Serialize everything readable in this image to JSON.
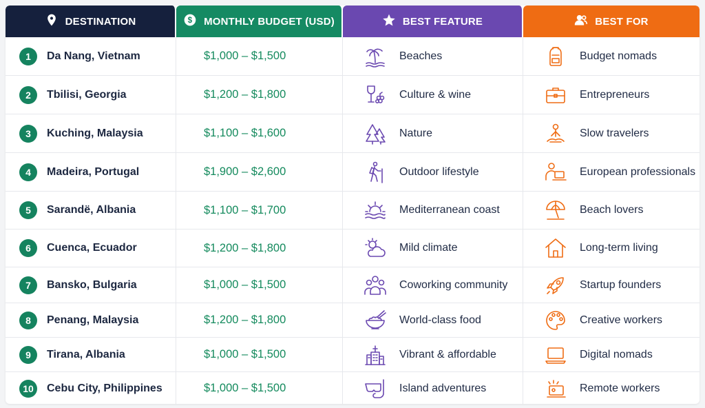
{
  "header": {
    "destination": "DESTINATION",
    "budget": "MONTHLY BUDGET (USD)",
    "feature": "BEST FEATURE",
    "best_for": "BEST FOR"
  },
  "colors": {
    "destination_header": "#15203d",
    "budget_header": "#158a63",
    "feature_header": "#6a48b0",
    "best_for_header": "#ef6c13",
    "rank_badge": "#15835f",
    "budget_text": "#148a5d",
    "feature_icon": "#6a48b0",
    "best_for_icon": "#ef6c13"
  },
  "rows": [
    {
      "rank": "1",
      "destination": "Da Nang, Vietnam",
      "budget": "$1,000 – $1,500",
      "feature": "Beaches",
      "feature_icon": "palm-beach-icon",
      "best_for": "Budget nomads",
      "best_for_icon": "backpack-icon"
    },
    {
      "rank": "2",
      "destination": "Tbilisi, Georgia",
      "budget": "$1,200 – $1,800",
      "feature": "Culture & wine",
      "feature_icon": "wine-grapes-icon",
      "best_for": "Entrepreneurs",
      "best_for_icon": "briefcase-icon"
    },
    {
      "rank": "3",
      "destination": "Kuching, Malaysia",
      "budget": "$1,100 – $1,600",
      "feature": "Nature",
      "feature_icon": "pine-trees-icon",
      "best_for": "Slow travelers",
      "best_for_icon": "meditation-icon"
    },
    {
      "rank": "4",
      "destination": "Madeira, Portugal",
      "budget": "$1,900 – $2,600",
      "feature": "Outdoor lifestyle",
      "feature_icon": "hiker-icon",
      "best_for": "European professionals",
      "best_for_icon": "person-laptop-icon"
    },
    {
      "rank": "5",
      "destination": "Sarandë, Albania",
      "budget": "$1,100 – $1,700",
      "feature": "Mediterranean coast",
      "feature_icon": "sun-waves-icon",
      "best_for": "Beach lovers",
      "best_for_icon": "umbrella-icon"
    },
    {
      "rank": "6",
      "destination": "Cuenca, Ecuador",
      "budget": "$1,200 – $1,800",
      "feature": "Mild climate",
      "feature_icon": "sun-cloud-icon",
      "best_for": "Long-term living",
      "best_for_icon": "house-icon"
    },
    {
      "rank": "7",
      "destination": "Bansko, Bulgaria",
      "budget": "$1,000 – $1,500",
      "feature": "Coworking community",
      "feature_icon": "people-group-icon",
      "best_for": "Startup founders",
      "best_for_icon": "rocket-icon"
    },
    {
      "rank": "8",
      "destination": "Penang, Malaysia",
      "budget": "$1,200 – $1,800",
      "feature": "World-class food",
      "feature_icon": "rice-bowl-icon",
      "best_for": "Creative workers",
      "best_for_icon": "palette-icon"
    },
    {
      "rank": "9",
      "destination": "Tirana, Albania",
      "budget": "$1,000 – $1,500",
      "feature": "Vibrant & affordable",
      "feature_icon": "city-buildings-icon",
      "best_for": "Digital nomads",
      "best_for_icon": "laptop-icon"
    },
    {
      "rank": "10",
      "destination": "Cebu City, Philippines",
      "budget": "$1,000 – $1,500",
      "feature": "Island adventures",
      "feature_icon": "snorkel-mask-icon",
      "best_for": "Remote workers",
      "best_for_icon": "remote-laptop-icon"
    }
  ]
}
